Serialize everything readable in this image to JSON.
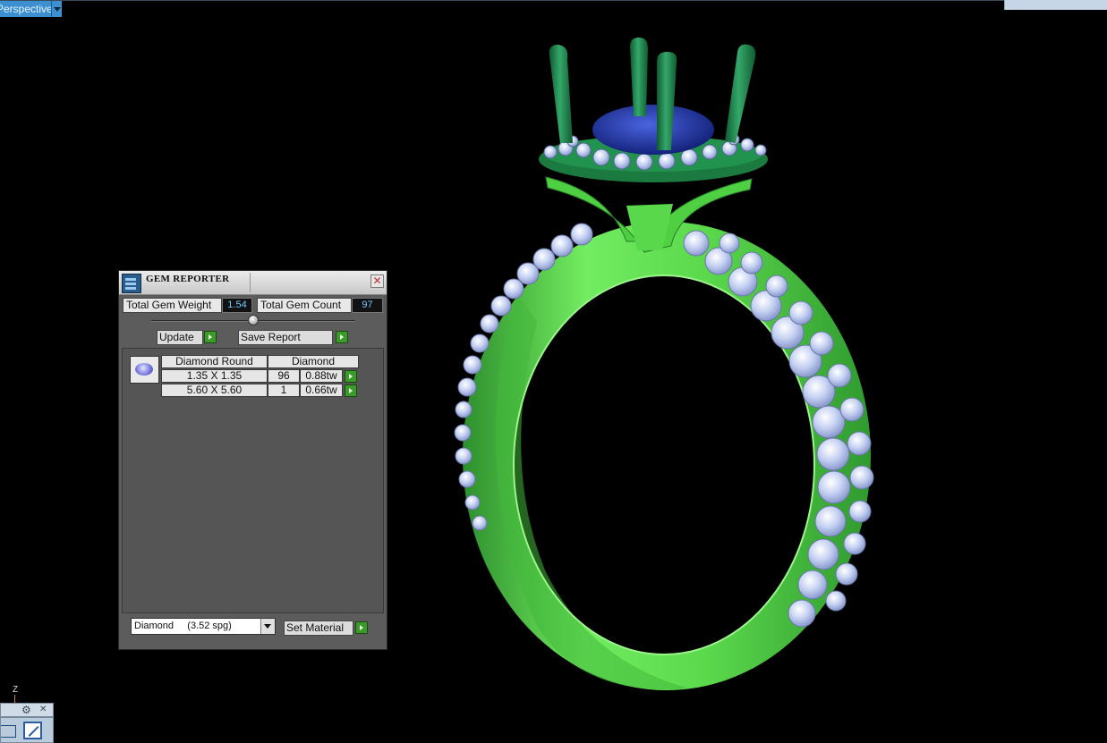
{
  "viewport": {
    "view_label": "Perspective"
  },
  "gem_reporter": {
    "title": "GEM REPORTER",
    "total_gem_weight_label": "Total Gem Weight",
    "total_gem_weight_value": "1.54",
    "total_gem_count_label": "Total Gem Count",
    "total_gem_count_value": "97",
    "update_label": "Update",
    "save_report_label": "Save Report",
    "table": {
      "headers": [
        "Diamond Round",
        "Diamond"
      ],
      "rows": [
        {
          "size": "1.35 X 1.35",
          "count": "96",
          "weight": "0.88tw"
        },
        {
          "size": "5.60 X 5.60",
          "count": "1",
          "weight": "0.66tw"
        }
      ]
    },
    "material_select": {
      "value": "Diamond     (3.52 spg)"
    },
    "set_material_label": "Set Material"
  },
  "axis": {
    "z_label": "Z"
  },
  "colors": {
    "metal": "#66e056",
    "metal_dark": "#2e8a2e",
    "head": "#1e7a45",
    "center_stone": "#2a3fb0",
    "pave_stone": "#b8c6ee",
    "panel_bg": "#5c5c5c",
    "accent_blue": "#3c8fd0"
  }
}
